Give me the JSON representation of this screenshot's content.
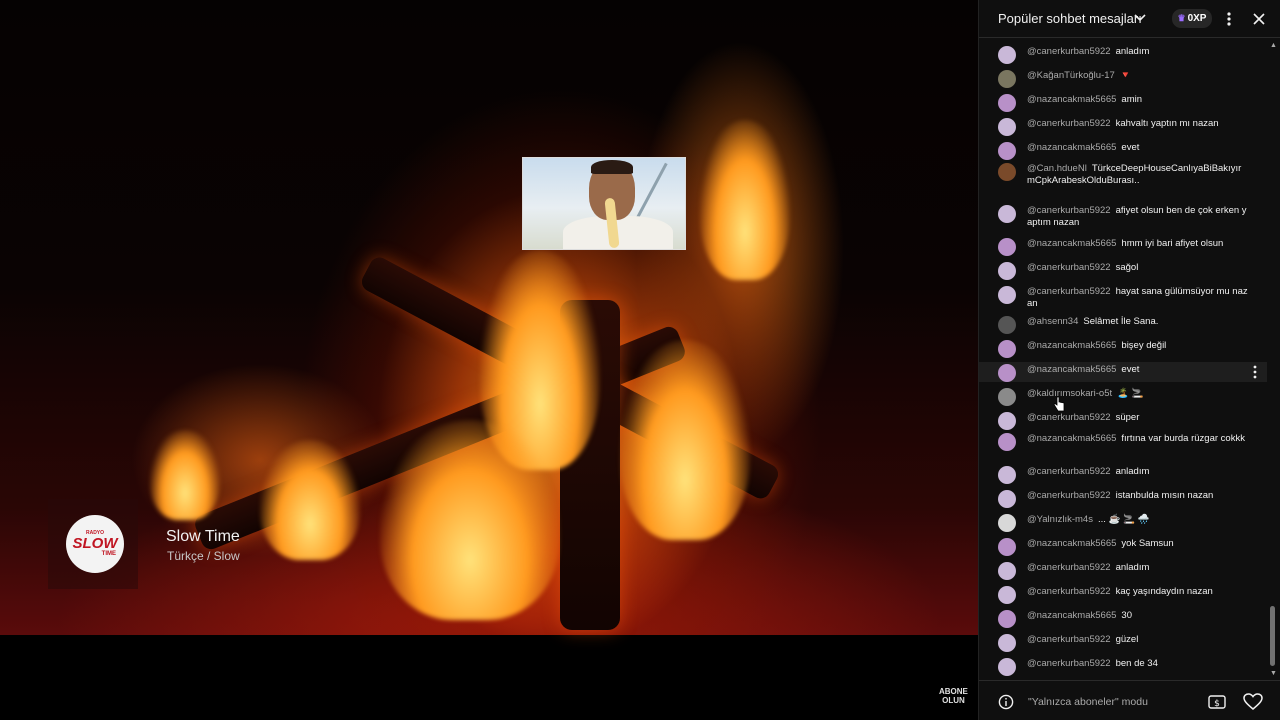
{
  "video": {
    "brand": {
      "logo_top": "RADYO",
      "logo_main": "SLOW",
      "logo_bottom": "TIME",
      "title": "Slow Time",
      "subtitle": "Türkçe / Slow"
    },
    "subscribe_label_1": "ABONE",
    "subscribe_label_2": "OLUN"
  },
  "chat": {
    "header": {
      "title": "Popüler sohbet mesajları",
      "xp": "0XP"
    },
    "messages": [
      {
        "user": "@canerkurban5922",
        "text": "anladım",
        "avatar": "#c9b8d8"
      },
      {
        "user": "@KağanTürkoğlu-17",
        "text": "🔻",
        "avatar": "#7a7660"
      },
      {
        "user": "@nazancakmak5665",
        "text": "amin",
        "avatar": "#b890c8"
      },
      {
        "user": "@canerkurban5922",
        "text": "kahvaltı yaptın mı nazan",
        "avatar": "#c9b8d8"
      },
      {
        "user": "@nazancakmak5665",
        "text": "evet",
        "avatar": "#b890c8"
      },
      {
        "user": "@Can.hdueNl",
        "text": "TürkceDeepHouseCanlıyaBiBakıyırmCpkArabeskOlduBurası..",
        "avatar": "#7a4a2a"
      },
      {
        "user": "@canerkurban5922",
        "text": "afiyet olsun ben de çok erken yaptım nazan",
        "avatar": "#c9b8d8"
      },
      {
        "user": "@nazancakmak5665",
        "text": "hmm iyi bari afiyet olsun",
        "avatar": "#b890c8"
      },
      {
        "user": "@canerkurban5922",
        "text": "sağol",
        "avatar": "#c9b8d8"
      },
      {
        "user": "@canerkurban5922",
        "text": "hayat sana gülümsüyor mu nazan",
        "avatar": "#c9b8d8"
      },
      {
        "user": "@ahsenn34",
        "text": "Selâmet İle Sana.",
        "avatar": "#555555"
      },
      {
        "user": "@nazancakmak5665",
        "text": "bişey değil",
        "avatar": "#b890c8"
      },
      {
        "user": "@nazancakmak5665",
        "text": "evet",
        "avatar": "#b890c8"
      },
      {
        "user": "@kaldırımsokari-o5t",
        "text": "🏝️ 🚬",
        "avatar": "#8a8a8a"
      },
      {
        "user": "@canerkurban5922",
        "text": "süper",
        "avatar": "#c9b8d8"
      },
      {
        "user": "@nazancakmak5665",
        "text": "fırtına var burda rüzgar cokkk",
        "avatar": "#b890c8"
      },
      {
        "user": "@canerkurban5922",
        "text": "anladım",
        "avatar": "#c9b8d8"
      },
      {
        "user": "@canerkurban5922",
        "text": "istanbulda mısın nazan",
        "avatar": "#c9b8d8"
      },
      {
        "user": "@Yalnızlık-m4s",
        "text": "... ☕ 🚬 🌧️",
        "avatar": "#d8d8d8"
      },
      {
        "user": "@nazancakmak5665",
        "text": "yok Samsun",
        "avatar": "#b890c8"
      },
      {
        "user": "@canerkurban5922",
        "text": "anladım",
        "avatar": "#c9b8d8"
      },
      {
        "user": "@canerkurban5922",
        "text": "kaç yaşındaydın nazan",
        "avatar": "#c9b8d8"
      },
      {
        "user": "@nazancakmak5665",
        "text": "30",
        "avatar": "#b890c8"
      },
      {
        "user": "@canerkurban5922",
        "text": "güzel",
        "avatar": "#c9b8d8"
      },
      {
        "user": "@canerkurban5922",
        "text": "ben de 34",
        "avatar": "#c9b8d8"
      }
    ],
    "highlighted_index": 12,
    "footer": {
      "mode_text": "\"Yalnızca aboneler\" modu"
    }
  },
  "colors": {
    "panel_bg": "#0f0f0f",
    "username": "#aaaaaa",
    "text": "#f1f1f1",
    "brand_red": "#c01522"
  }
}
